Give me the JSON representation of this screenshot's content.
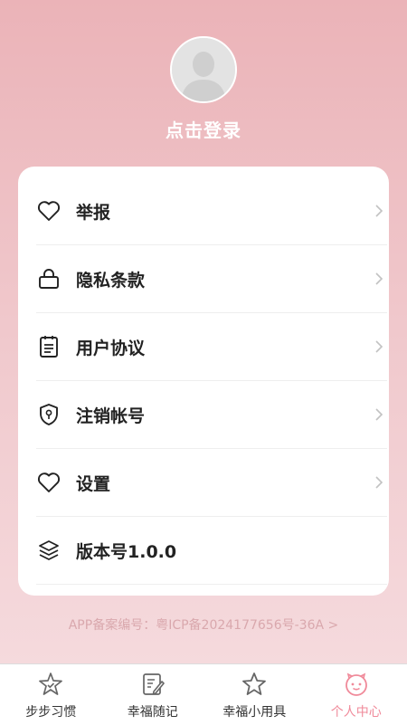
{
  "profile": {
    "login_text": "点击登录"
  },
  "menu": {
    "items": [
      {
        "icon": "heart-icon",
        "label": "举报",
        "arrow": true
      },
      {
        "icon": "lock-icon",
        "label": "隐私条款",
        "arrow": true
      },
      {
        "icon": "document-icon",
        "label": "用户协议",
        "arrow": true
      },
      {
        "icon": "shield-icon",
        "label": "注销帐号",
        "arrow": true
      },
      {
        "icon": "heart-icon",
        "label": "设置",
        "arrow": true
      },
      {
        "icon": "layers-icon",
        "label": "版本号1.0.0",
        "arrow": false
      }
    ]
  },
  "icp": {
    "text": "APP备案编号：粤ICP备2024177656号-36A >"
  },
  "tabbar": {
    "tabs": [
      {
        "icon": "star-badge-icon",
        "label": "步步习惯",
        "active": false
      },
      {
        "icon": "edit-note-icon",
        "label": "幸福随记",
        "active": false
      },
      {
        "icon": "star-icon",
        "label": "幸福小用具",
        "active": false
      },
      {
        "icon": "smiley-icon",
        "label": "个人中心",
        "active": true
      }
    ]
  },
  "colors": {
    "accent": "#f08a9a",
    "gradient_top": "#ebb3b8",
    "gradient_bottom": "#f6dde0"
  }
}
